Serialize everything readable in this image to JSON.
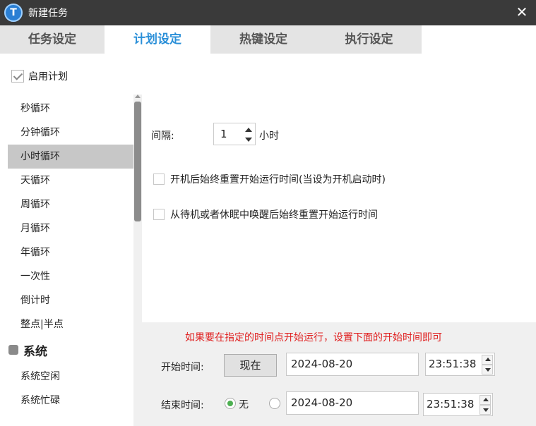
{
  "window": {
    "title": "新建任务"
  },
  "tabs": [
    {
      "label": "任务设定"
    },
    {
      "label": "计划设定"
    },
    {
      "label": "热键设定"
    },
    {
      "label": "执行设定"
    }
  ],
  "enable_plan": {
    "label": "启用计划",
    "checked": true
  },
  "schedule_list": {
    "items": [
      "秒循环",
      "分钟循环",
      "小时循环",
      "天循环",
      "周循环",
      "月循环",
      "年循环",
      "一次性",
      "倒计时",
      "整点|半点"
    ],
    "selected": "小时循环",
    "group": {
      "label": "系统"
    },
    "group_items": [
      "系统空闲",
      "系统忙碌"
    ]
  },
  "interval": {
    "label": "间隔:",
    "value": "1",
    "unit": "小时"
  },
  "options": [
    {
      "label": "开机后始终重置开始运行时间(当设为开机启动时)",
      "checked": false
    },
    {
      "label": "从待机或者休眠中唤醒后始终重置开始运行时间",
      "checked": false
    }
  ],
  "bottom": {
    "hint": "如果要在指定的时间点开始运行，设置下面的开始时间即可",
    "start": {
      "label": "开始时间:",
      "now_button": "现在",
      "date": "2024-08-20",
      "time": "23:51:38"
    },
    "end": {
      "label": "结束时间:",
      "none_label": "无",
      "date": "2024-08-20",
      "time": "23:51:38"
    }
  },
  "colors": {
    "accent": "#2a8fd8",
    "hint": "#e02020",
    "titlebar": "#3a3a3a",
    "selected_item": "#c7c7c7"
  }
}
